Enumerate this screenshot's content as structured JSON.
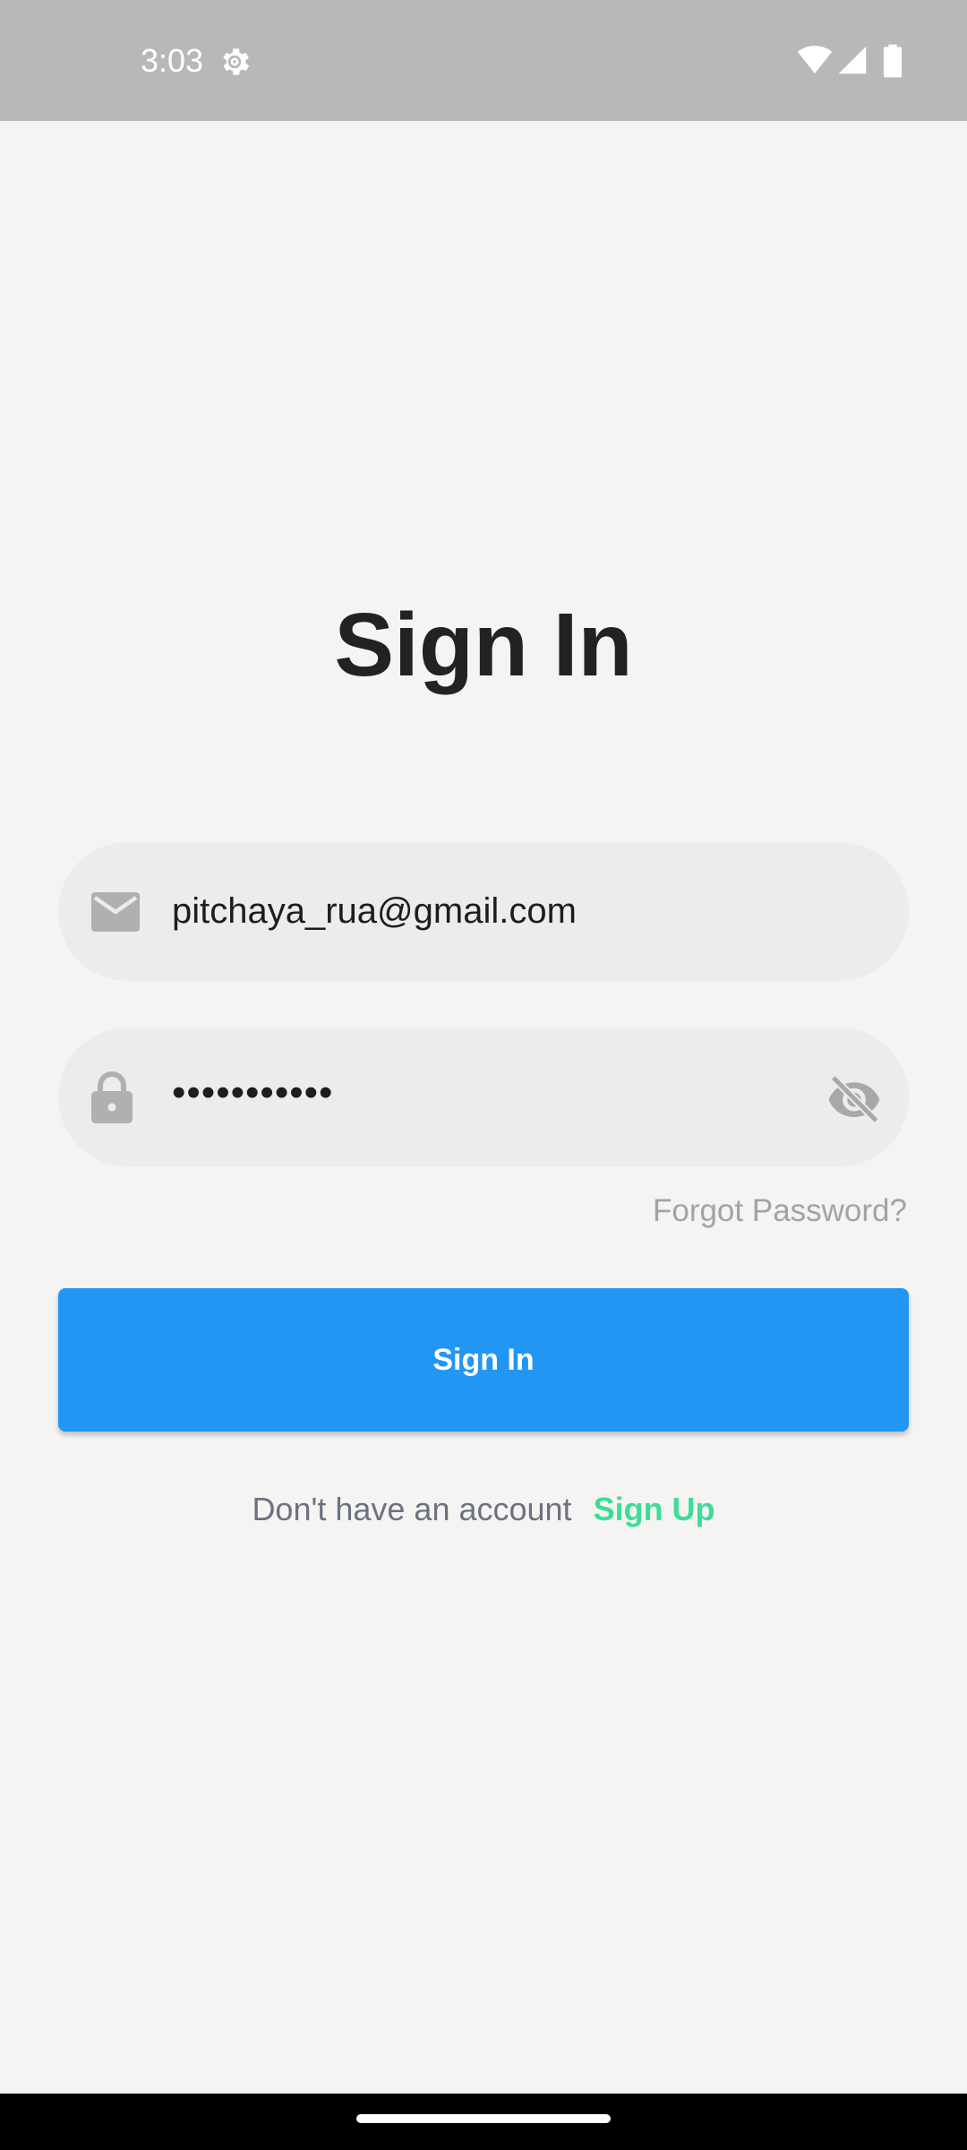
{
  "status_bar": {
    "time": "3:03",
    "icons": [
      "settings-icon",
      "wifi-icon",
      "signal-icon",
      "battery-icon"
    ]
  },
  "screen": {
    "title": "Sign In"
  },
  "email_field": {
    "value": "pitchaya_rua@gmail.com",
    "icon": "mail-icon"
  },
  "password_field": {
    "value": "•••••••••••",
    "icon": "lock-icon",
    "toggle_icon": "eye-off-icon"
  },
  "forgot_password": {
    "label": "Forgot Password?"
  },
  "signin_button": {
    "label": "Sign In",
    "color": "#2296f3"
  },
  "signup": {
    "prompt": "Don't have an account",
    "link_label": "Sign Up",
    "link_color": "#3ddc97"
  },
  "colors": {
    "background": "#f5f4f2",
    "field_background": "#ececec",
    "status_bar": "#b9b8b6"
  }
}
